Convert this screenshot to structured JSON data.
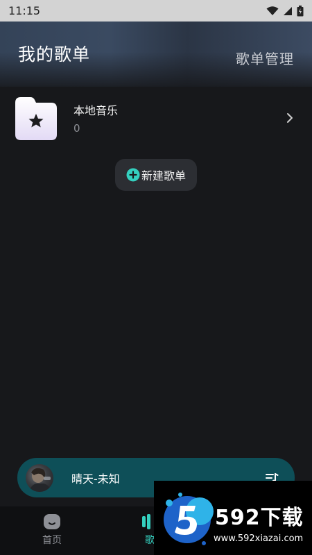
{
  "status_bar": {
    "time": "11:15"
  },
  "header": {
    "title": "我的歌单",
    "manage_label": "歌单管理"
  },
  "playlists": [
    {
      "title": "本地音乐",
      "count": "0"
    }
  ],
  "new_playlist": {
    "label": "新建歌单"
  },
  "mini_player": {
    "song": "晴天-未知"
  },
  "tabs": [
    {
      "label": "首页",
      "active": false
    },
    {
      "label": "歌",
      "active": true
    }
  ],
  "watermark": {
    "brand": "592下载",
    "url": "www.592xiazai.com"
  },
  "colors": {
    "accent": "#34d0bf",
    "player_bg": "#0e4f58",
    "background": "#17181b"
  }
}
